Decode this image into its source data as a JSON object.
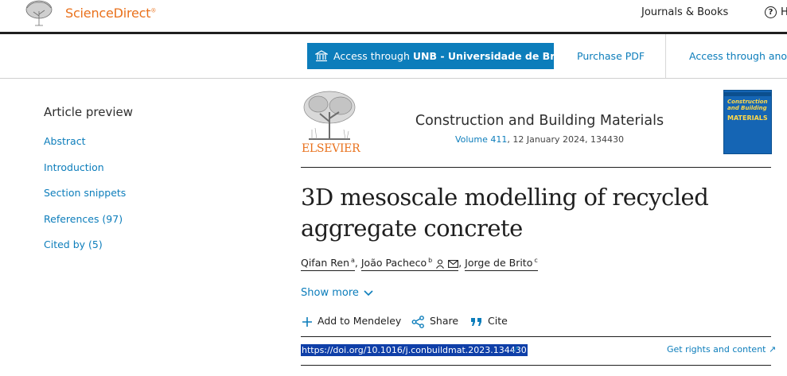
{
  "header": {
    "brand": "ScienceDirect",
    "brand_mark": "®",
    "journals_link": "Journals & Books",
    "help_label": "H",
    "help_icon_glyph": "?"
  },
  "access_bar": {
    "access_prefix": "Access through ",
    "access_institution": "UNB - Universidade de Bra...",
    "purchase_pdf": "Purchase PDF",
    "access_other": "Access through anot"
  },
  "sidebar": {
    "title": "Article preview",
    "items": [
      {
        "label": "Abstract"
      },
      {
        "label": "Introduction"
      },
      {
        "label": "Section snippets"
      },
      {
        "label": "References (97)"
      },
      {
        "label": "Cited by (5)"
      }
    ]
  },
  "journal": {
    "publisher": "ELSEVIER",
    "title": "Construction and Building Materials",
    "volume": "Volume 411",
    "date_article": ", 12 January 2024, 134430",
    "cover_title": "Construction and Building",
    "cover_big": "MATERIALS"
  },
  "article": {
    "title_line1": "3D mesoscale modelling of recycled",
    "title_line2": "aggregate concrete",
    "authors": [
      {
        "name": "Qifan Ren",
        "aff": "a",
        "sep": ", "
      },
      {
        "name": "João Pacheco",
        "aff": "b",
        "sep": ", "
      },
      {
        "name": "Jorge de Brito",
        "aff": "c",
        "sep": ""
      }
    ],
    "show_more": "Show more",
    "actions": {
      "mendeley": "Add to Mendeley",
      "share": "Share",
      "cite": "Cite"
    },
    "doi": "https://doi.org/10.1016/j.conbuildmat.2023.134430",
    "doi_arrow": "↗",
    "get_rights": "Get rights and content ↗"
  },
  "colors": {
    "brand_orange": "#e9711c",
    "link_blue": "#0c7dbb",
    "access_button": "#0c7dbb",
    "doi_highlight": "#0f3fa8"
  }
}
